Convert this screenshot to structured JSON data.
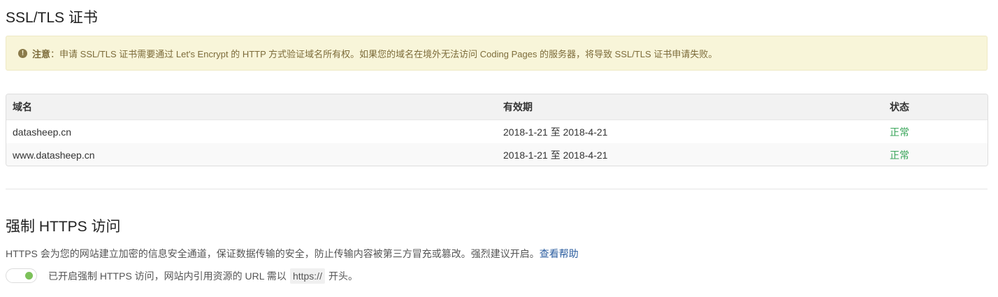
{
  "ssl_section": {
    "title": "SSL/TLS 证书",
    "notice": {
      "icon": "exclamation-circle-icon",
      "label": "注意",
      "separator": "：",
      "text": "申请 SSL/TLS 证书需要通过 Let's Encrypt 的 HTTP 方式验证域名所有权。如果您的域名在境外无法访问 Coding Pages 的服务器，将导致 SSL/TLS 证书申请失败。"
    },
    "table": {
      "headers": {
        "domain": "域名",
        "validity": "有效期",
        "status": "状态"
      },
      "rows": [
        {
          "domain": "datasheep.cn",
          "validity": "2018-1-21 至 2018-4-21",
          "status": "正常"
        },
        {
          "domain": "www.datasheep.cn",
          "validity": "2018-1-21 至 2018-4-21",
          "status": "正常"
        }
      ]
    }
  },
  "https_section": {
    "title": "强制 HTTPS 访问",
    "description": "HTTPS 会为您的网站建立加密的信息安全通道，保证数据传输的安全，防止传输内容被第三方冒充或篡改。强烈建议开启。",
    "help_link": "查看帮助",
    "toggle": {
      "enabled": true,
      "text_before": "已开启强制 HTTPS 访问，网站内引用资源的 URL 需以",
      "code": "https://",
      "text_after": "开头。"
    }
  },
  "colors": {
    "notice_bg": "#f8f5d9",
    "status_ok": "#3aa55a",
    "link": "#2b5d9f",
    "toggle_on": "#7cc15a"
  }
}
